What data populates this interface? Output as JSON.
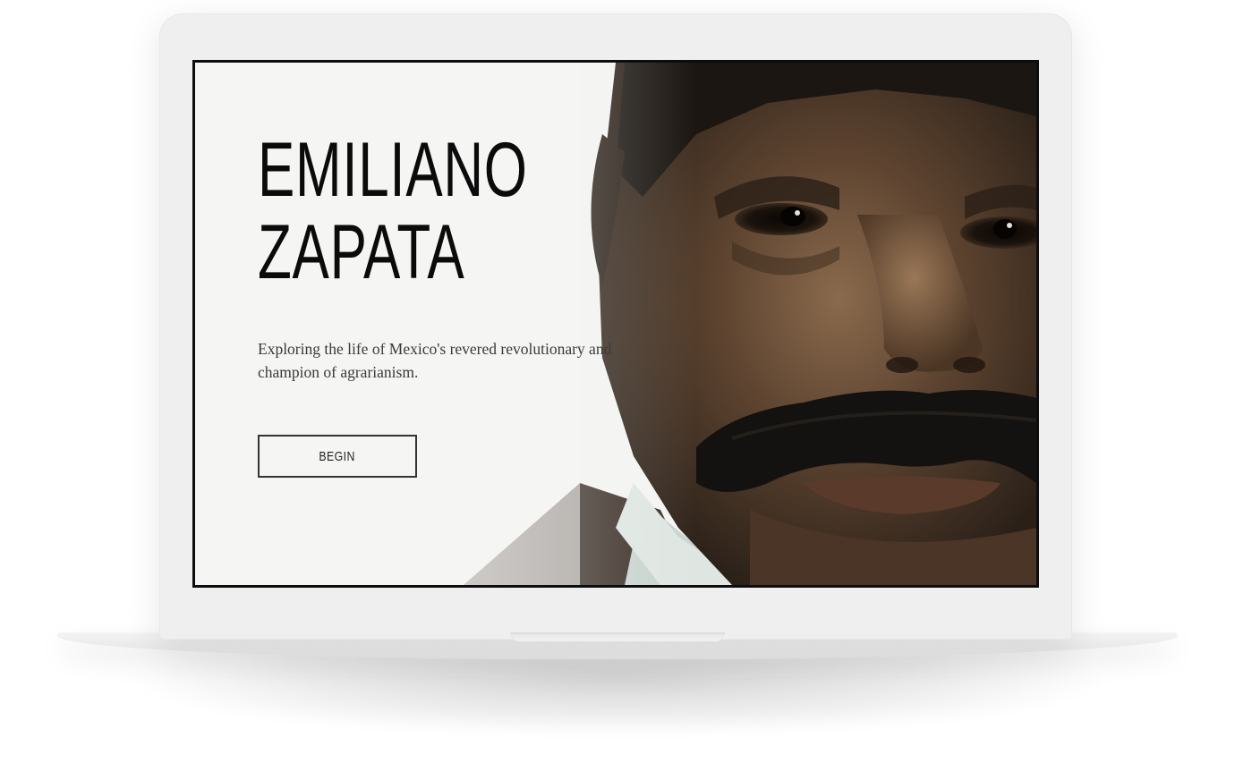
{
  "hero": {
    "title_line1": "EMILIANO",
    "title_line2": "ZAPATA",
    "subtitle": "Exploring the life of Mexico's revered revolutionary and champion of agrarianism.",
    "cta_label": "BEGIN"
  },
  "portrait": {
    "icon": "portrait-photo",
    "colors": {
      "skin": "#5b4330",
      "hair": "#1b1612",
      "background": "#f5f5f3"
    }
  }
}
